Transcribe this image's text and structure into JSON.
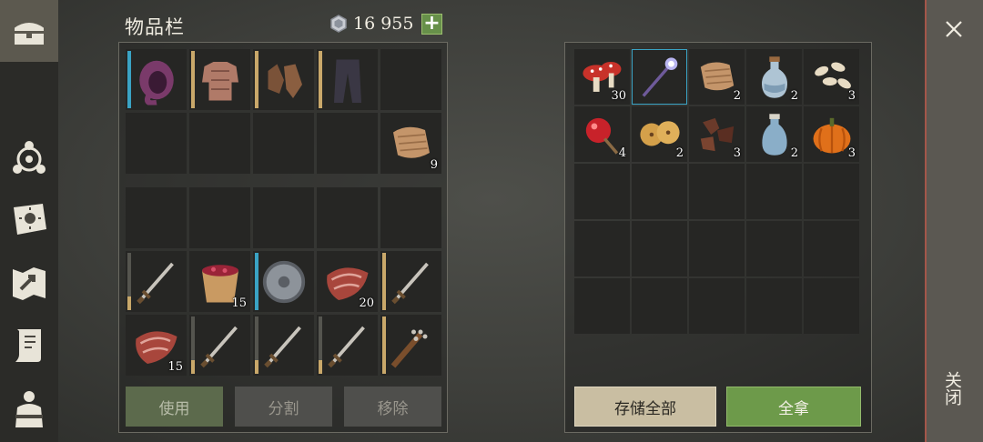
{
  "header": {
    "title": "物品栏",
    "currency": "16  955",
    "plus_label": "+"
  },
  "sidebar": {
    "items": [
      {
        "name": "chest-icon"
      },
      {
        "name": "character-icon"
      },
      {
        "name": "sun-book-icon"
      },
      {
        "name": "map-icon"
      },
      {
        "name": "scroll-quest-icon"
      },
      {
        "name": "backpack-icon"
      }
    ]
  },
  "inventory": {
    "equipment": [
      {
        "icon": "hood-icon",
        "count": "",
        "bar": "blue"
      },
      {
        "icon": "chest-armor-icon",
        "count": "",
        "bar": "gold"
      },
      {
        "icon": "gloves-icon",
        "count": "",
        "bar": "gold"
      },
      {
        "icon": "pants-icon",
        "count": "",
        "bar": "gold"
      },
      {
        "icon": "",
        "count": "",
        "bar": ""
      },
      {
        "icon": "",
        "count": "",
        "bar": ""
      },
      {
        "icon": "",
        "count": "",
        "bar": ""
      },
      {
        "icon": "",
        "count": "",
        "bar": ""
      },
      {
        "icon": "",
        "count": "",
        "bar": ""
      },
      {
        "icon": "cloth-icon",
        "count": "9",
        "bar": ""
      }
    ],
    "backpack": [
      {
        "icon": "",
        "count": "",
        "bar": ""
      },
      {
        "icon": "",
        "count": "",
        "bar": ""
      },
      {
        "icon": "",
        "count": "",
        "bar": ""
      },
      {
        "icon": "",
        "count": "",
        "bar": ""
      },
      {
        "icon": "",
        "count": "",
        "bar": ""
      },
      {
        "icon": "sword-icon",
        "count": "",
        "bar": "gold-grey"
      },
      {
        "icon": "berry-bucket-icon",
        "count": "15",
        "bar": ""
      },
      {
        "icon": "round-shield-icon",
        "count": "",
        "bar": "blue"
      },
      {
        "icon": "raw-meat-icon",
        "count": "20",
        "bar": ""
      },
      {
        "icon": "sword-icon",
        "count": "",
        "bar": "gold"
      },
      {
        "icon": "raw-meat-icon",
        "count": "15",
        "bar": ""
      },
      {
        "icon": "sword-icon",
        "count": "",
        "bar": "gold-grey"
      },
      {
        "icon": "sword-icon",
        "count": "",
        "bar": "gold-grey"
      },
      {
        "icon": "sword-icon",
        "count": "",
        "bar": "gold-grey"
      },
      {
        "icon": "spiked-club-icon",
        "count": "",
        "bar": "gold"
      }
    ],
    "buttons": {
      "use": "使用",
      "split": "分割",
      "remove": "移除"
    }
  },
  "storage": {
    "slots": [
      {
        "icon": "mushroom-icon",
        "count": "30"
      },
      {
        "icon": "magic-staff-icon",
        "count": "",
        "selected": true
      },
      {
        "icon": "cloth-icon",
        "count": "2"
      },
      {
        "icon": "potion-bottle-icon",
        "count": "2"
      },
      {
        "icon": "seeds-icon",
        "count": "3"
      },
      {
        "icon": "candy-apple-icon",
        "count": "4"
      },
      {
        "icon": "cookies-icon",
        "count": "2"
      },
      {
        "icon": "leather-scraps-icon",
        "count": "3"
      },
      {
        "icon": "water-bottle-icon",
        "count": "2"
      },
      {
        "icon": "pumpkin-icon",
        "count": "3"
      }
    ],
    "total_slots": 25,
    "buttons": {
      "store_all": "存储全部",
      "take_all": "全拿"
    }
  },
  "close": {
    "label": "关闭"
  },
  "colors": {
    "accent_green": "#6d9a4a",
    "selection_blue": "#3aa3c4",
    "durability_gold": "#c9a86a",
    "close_border": "#a4564a"
  }
}
